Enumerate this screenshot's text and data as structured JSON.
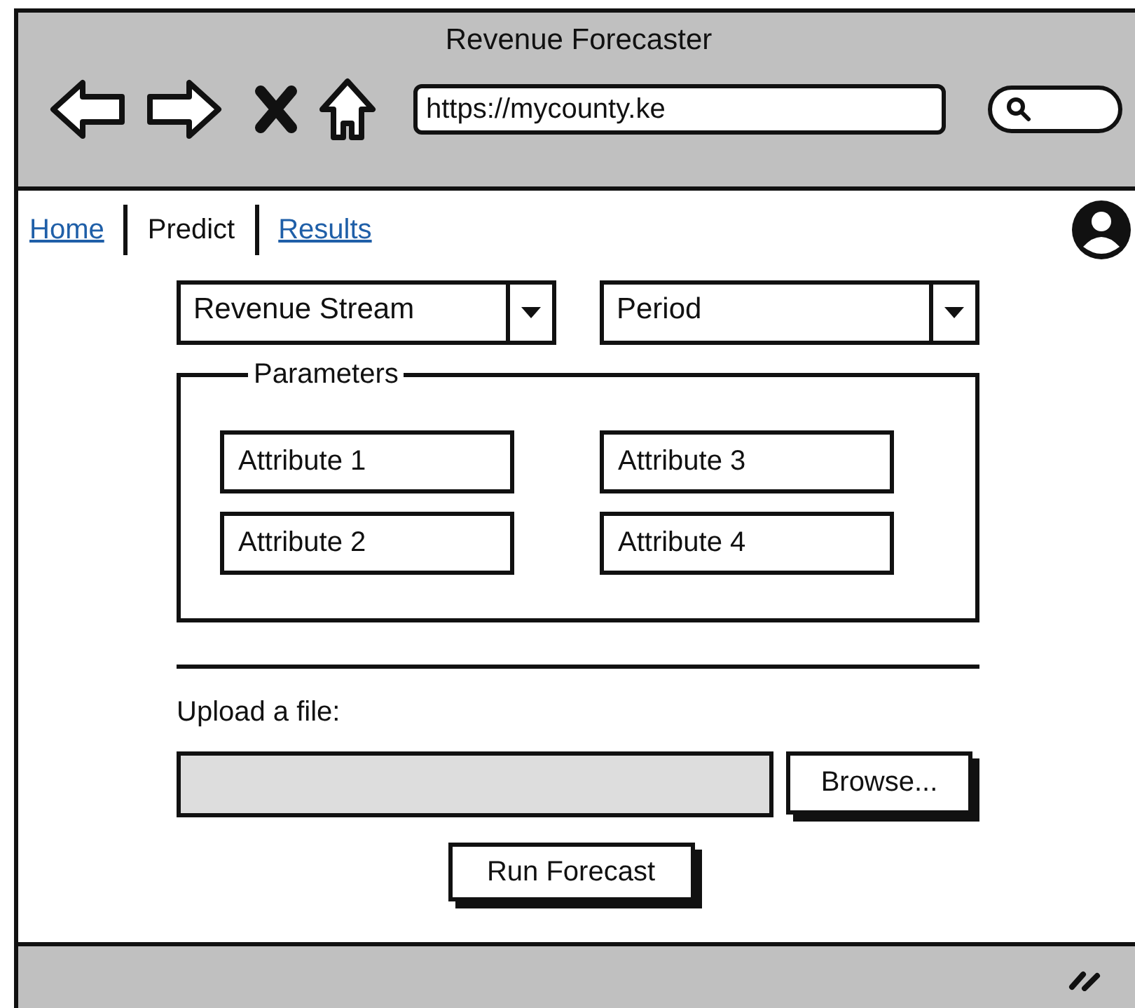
{
  "window": {
    "title": "Revenue Forecaster"
  },
  "browser": {
    "url": "https://mycounty.ke"
  },
  "nav": [
    {
      "label": "Home",
      "selected": false
    },
    {
      "label": "Predict",
      "selected": true
    },
    {
      "label": "Results",
      "selected": false
    }
  ],
  "selects": [
    {
      "value": "Revenue Stream"
    },
    {
      "value": "Period"
    }
  ],
  "parameters": {
    "title": "Parameters",
    "fields": [
      {
        "value": "Attribute 1"
      },
      {
        "value": "Attribute 2"
      },
      {
        "value": "Attribute 3"
      },
      {
        "value": "Attribute 4"
      }
    ]
  },
  "upload": {
    "label": "Upload a file:",
    "browse": "Browse..."
  },
  "run_button": "Run Forecast"
}
